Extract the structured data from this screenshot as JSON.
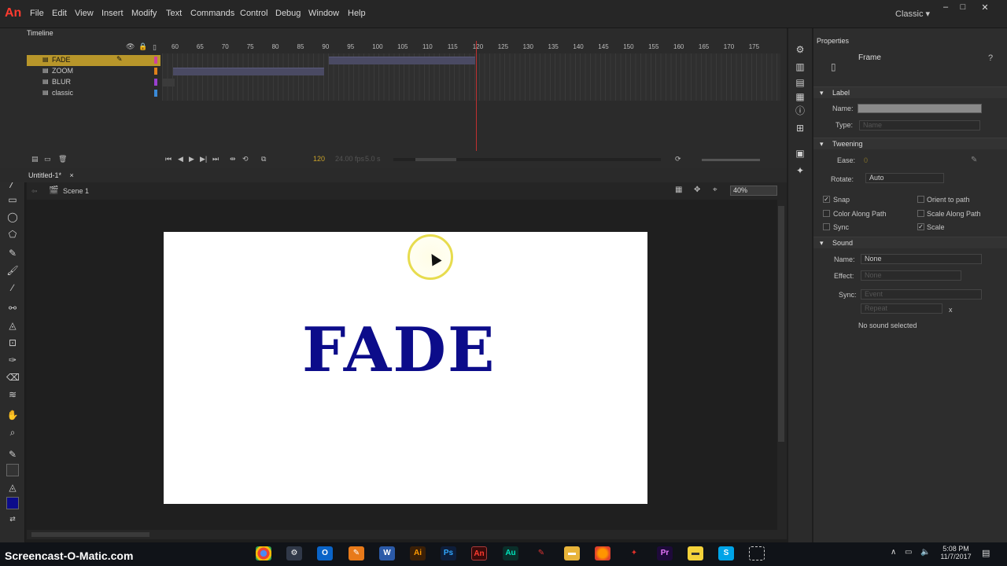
{
  "app": {
    "logo": "An",
    "workspace": "Classic ▾"
  },
  "menu": [
    "File",
    "Edit",
    "View",
    "Insert",
    "Modify",
    "Text",
    "Commands",
    "Control",
    "Debug",
    "Window",
    "Help"
  ],
  "window_controls": {
    "minimize": "–",
    "maximize": "□",
    "close": "✕"
  },
  "timeline": {
    "tab": "Timeline",
    "layers": [
      {
        "name": "FADE",
        "selected": true,
        "color": "#d040a0"
      },
      {
        "name": "ZOOM",
        "selected": false,
        "color": "#e0801a"
      },
      {
        "name": "BLUR",
        "selected": false,
        "color": "#9a40d0"
      },
      {
        "name": "classic",
        "selected": false,
        "color": "#3a8ad8"
      }
    ],
    "ruler": [
      "60",
      "65",
      "70",
      "75",
      "80",
      "85",
      "90",
      "95",
      "100",
      "105",
      "110",
      "115",
      "120",
      "125",
      "130",
      "135",
      "140",
      "145",
      "150",
      "155",
      "160",
      "165",
      "170",
      "175"
    ],
    "current_frame": "120",
    "fps": "24.00 fps",
    "time": "5.0 s",
    "playhead_frame": 120
  },
  "document": {
    "tab": "Untitled-1*",
    "tab_close": "×",
    "scene": "Scene 1",
    "zoom": "40%"
  },
  "stage": {
    "text": "FADE",
    "text_color": "#0c0c8a",
    "background": "#ffffff"
  },
  "properties": {
    "tab": "Properties",
    "frame_title": "Frame",
    "label_section": "Label",
    "name_label": "Name:",
    "type_label": "Type:",
    "type_value": "Name",
    "tweening_section": "Tweening",
    "ease_label": "Ease:",
    "ease_value": "0",
    "rotate_label": "Rotate:",
    "rotate_value": "Auto",
    "snap": "Snap",
    "orient_to_path": "Orient to path",
    "color_along_path": "Color Along Path",
    "scale_along_path": "Scale Along Path",
    "sync": "Sync",
    "scale": "Scale",
    "sound_section": "Sound",
    "sound_name_label": "Name:",
    "sound_name_value": "None",
    "effect_label": "Effect:",
    "effect_value": "None",
    "sync_label": "Sync:",
    "sync_value": "Event",
    "repeat_value": "Repeat",
    "repeat_count": "x",
    "no_sound": "No sound selected"
  },
  "taskbar": {
    "watermark": "Screencast-O-Matic.com",
    "apps": [
      "Chrome",
      "Settings",
      "Outlook",
      "Brush",
      "Word",
      "Illustrator",
      "Photoshop",
      "Animate",
      "Audition",
      "Pen",
      "Explorer",
      "Firefox",
      "Acrobat",
      "Premiere",
      "Notes",
      "Skype",
      "Snip"
    ],
    "time": "5:08 PM",
    "date": "11/7/2017"
  }
}
